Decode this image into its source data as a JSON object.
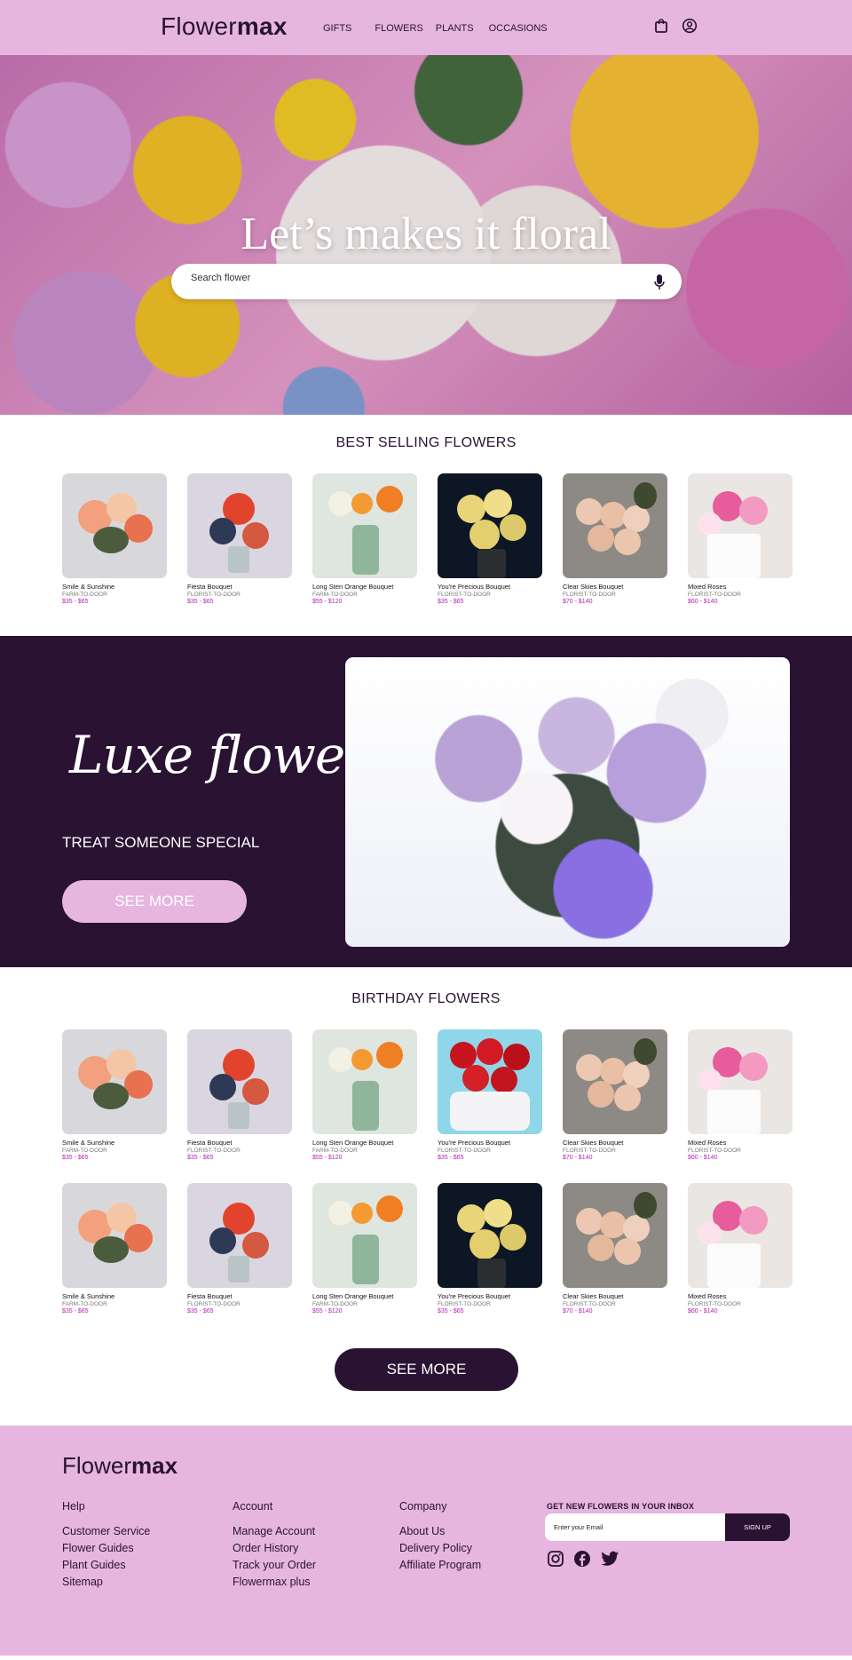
{
  "nav": {
    "brand_light": "Flower",
    "brand_bold": "max",
    "links": [
      "GIFTS",
      "FLOWERS",
      "PLANTS",
      "OCCASIONS"
    ]
  },
  "hero": {
    "title": "Let’s makes it floral",
    "search_placeholder": "Search flower"
  },
  "best_selling": {
    "title": "BEST SELLING FLOWERS",
    "items": [
      {
        "name": "Smile & Sunshine",
        "sub": "FARM-TO-DOOR",
        "price": "$35 - $65"
      },
      {
        "name": "Fiesta Bouquet",
        "sub": "FLORIST-TO-DOOR",
        "price": "$35 - $65"
      },
      {
        "name": "Long Sten Orange Bouquet",
        "sub": "FARM-TO-DOOR",
        "price": "$55 - $120"
      },
      {
        "name": "You're Precious Bouquet",
        "sub": "FLORIST-TO-DOOR",
        "price": "$35 - $65"
      },
      {
        "name": "Clear Skies Bouquet",
        "sub": "FLORIST-TO-DOOR",
        "price": "$70 - $140"
      },
      {
        "name": "Mixed Roses",
        "sub": "FLORIST-TO-DOOR",
        "price": "$60 - $140"
      }
    ]
  },
  "luxe": {
    "script": "Luxe flower",
    "subtitle": "TREAT SOMEONE SPECIAL",
    "button": "SEE MORE"
  },
  "birthday": {
    "title": "BIRTHDAY FLOWERS",
    "row1": [
      {
        "name": "Smile & Sunshine",
        "sub": "FARM-TO-DOOR",
        "price": "$35 - $65"
      },
      {
        "name": "Fiesta Bouquet",
        "sub": "FLORIST-TO-DOOR",
        "price": "$35 - $65"
      },
      {
        "name": "Long Sten Orange Bouquet",
        "sub": "FARM-TO-DOOR",
        "price": "$55 - $120"
      },
      {
        "name": "You're Precious Bouquet",
        "sub": "FLORIST-TO-DOOR",
        "price": "$35 - $65"
      },
      {
        "name": "Clear Skies Bouquet",
        "sub": "FLORIST-TO-DOOR",
        "price": "$70 - $140"
      },
      {
        "name": "Mixed Roses",
        "sub": "FLORIST-TO-DOOR",
        "price": "$60 - $140"
      }
    ],
    "row2": [
      {
        "name": "Smile & Sunshine",
        "sub": "FARM-TO-DOOR",
        "price": "$35 - $65"
      },
      {
        "name": "Fiesta Bouquet",
        "sub": "FLORIST-TO-DOOR",
        "price": "$35 - $65"
      },
      {
        "name": "Long Sten Orange Bouquet",
        "sub": "FARM-TO-DOOR",
        "price": "$55 - $120"
      },
      {
        "name": "You're Precious Bouquet",
        "sub": "FLORIST-TO-DOOR",
        "price": "$35 - $65"
      },
      {
        "name": "Clear Skies Bouquet",
        "sub": "FLORIST-TO-DOOR",
        "price": "$70 - $140"
      },
      {
        "name": "Mixed Roses",
        "sub": "FLORIST-TO-DOOR",
        "price": "$60 - $140"
      }
    ],
    "button": "SEE MORE"
  },
  "footer": {
    "brand_light": "Flower",
    "brand_bold": "max",
    "cols": [
      {
        "head": "Help",
        "links": [
          "Customer Service",
          "Flower Guides",
          "Plant Guides",
          "Sitemap"
        ]
      },
      {
        "head": "Account",
        "links": [
          "Manage Account",
          "Order History",
          "Track your Order",
          "Flowermax plus"
        ]
      },
      {
        "head": "Company",
        "links": [
          "About Us",
          "Delivery Policy",
          "Affiliate Program"
        ]
      }
    ],
    "newsletter_title": "GET NEW FLOWERS IN YOUR INBOX",
    "email_placeholder": "Enter your Email",
    "signup": "SIGN UP"
  },
  "colors": {
    "nav_bg": "#e6b6e0",
    "dark": "#2a1233",
    "price": "#b51fb5"
  },
  "icons": [
    "bag-icon",
    "user-icon",
    "microphone-icon",
    "instagram-icon",
    "facebook-icon",
    "twitter-icon"
  ]
}
